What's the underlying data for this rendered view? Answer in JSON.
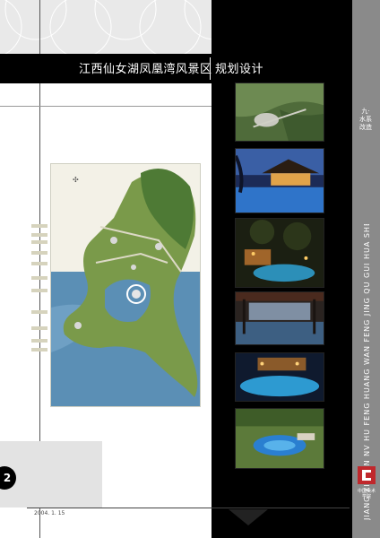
{
  "header": {
    "title": "江西仙女湖凤凰湾风景区",
    "subtitle": "规划设计"
  },
  "side": {
    "section": "九·水系改造",
    "pinyin": "JIANG XI XIAN NV HU FENG HUANG WAN FENG JING QU GUI HUA SHE JI",
    "logo_text": "中国美术学院"
  },
  "footer": {
    "page_number": "2",
    "date": "2004. 1. 15"
  },
  "photos": [
    {
      "subject": "aerial view of lakeside pavilion"
    },
    {
      "subject": "resort pool at dusk"
    },
    {
      "subject": "night pool with lanterns"
    },
    {
      "subject": "pavilion overlooking water"
    },
    {
      "subject": "illuminated resort pool"
    },
    {
      "subject": "tropical pool with gardens"
    }
  ],
  "colors": {
    "black": "#000000",
    "strip_grey": "#8a8a8a",
    "logo_red": "#c0282c",
    "water_blue": "#5b8fb5",
    "land_green": "#7a9a4a"
  }
}
